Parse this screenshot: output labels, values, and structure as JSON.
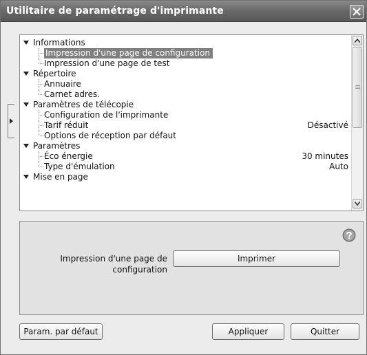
{
  "window": {
    "title": "Utilitaire de paramétrage d'imprimante"
  },
  "tree": {
    "rows": [
      {
        "kind": "category",
        "label": "Informations",
        "value": ""
      },
      {
        "kind": "child",
        "label": "Impression d'une page de configuration",
        "value": "",
        "selected": true
      },
      {
        "kind": "child",
        "label": "Impression d'une page de test",
        "value": ""
      },
      {
        "kind": "category",
        "label": "Répertoire",
        "value": ""
      },
      {
        "kind": "child",
        "label": "Annuaire",
        "value": ""
      },
      {
        "kind": "child",
        "label": "Carnet adres.",
        "value": ""
      },
      {
        "kind": "category",
        "label": "Paramètres de télécopie",
        "value": ""
      },
      {
        "kind": "child",
        "label": "Configuration de l'imprimante",
        "value": ""
      },
      {
        "kind": "child",
        "label": "Tarif réduit",
        "value": "Désactivé"
      },
      {
        "kind": "child",
        "label": "Options de réception par défaut",
        "value": ""
      },
      {
        "kind": "category",
        "label": "Paramètres",
        "value": ""
      },
      {
        "kind": "child",
        "label": "Éco énergie",
        "value": "30 minutes"
      },
      {
        "kind": "child",
        "label": "Type d'émulation",
        "value": "Auto"
      },
      {
        "kind": "category",
        "label": "Mise en page",
        "value": ""
      }
    ]
  },
  "detail": {
    "label": "Impression d'une page de configuration",
    "print_button": "Imprimer"
  },
  "footer": {
    "default_button": "Param. par défaut",
    "apply_button": "Appliquer",
    "quit_button": "Quitter"
  }
}
